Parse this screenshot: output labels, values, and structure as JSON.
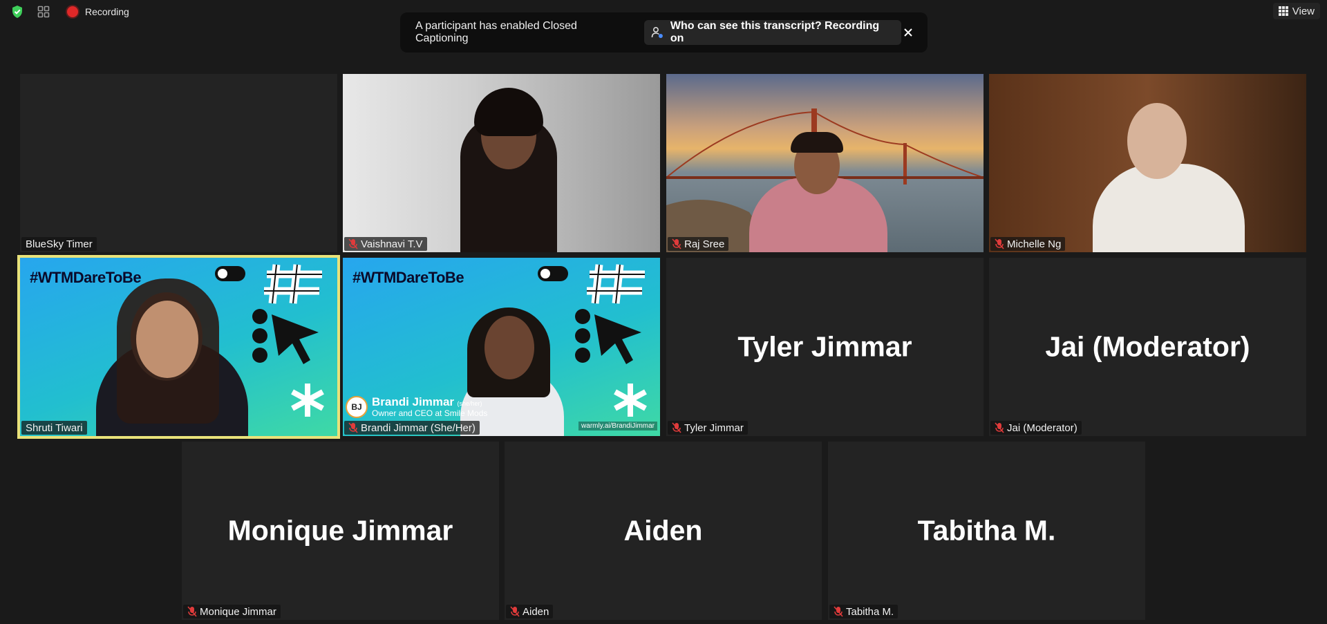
{
  "topbar": {
    "recording_label": "Recording",
    "view_label": "View"
  },
  "banner": {
    "message": "A participant has enabled Closed Captioning",
    "transcript_button": "Who can see this transcript? Recording on"
  },
  "tiles": [
    {
      "name": "BlueSky Timer",
      "muted": false
    },
    {
      "name": "Vaishnavi T.V",
      "muted": true
    },
    {
      "name": "Raj Sree",
      "muted": true
    },
    {
      "name": "Michelle Ng",
      "muted": true
    },
    {
      "name": "Shruti Tiwari",
      "muted": false,
      "active_speaker": true,
      "background_text": "#WTMDareToBe"
    },
    {
      "name": "Brandi Jimmar (She/Her)",
      "muted": true,
      "background_text": "#WTMDareToBe",
      "lower_third_name": "Brandi Jimmar",
      "lower_third_pronoun": "(she/her)",
      "lower_third_role": "Owner and CEO at Smile Mods",
      "badge": "BJ",
      "url": "warmly.ai/BrandiJimmar"
    },
    {
      "name": "Tyler Jimmar",
      "muted": true,
      "display_name": "Tyler Jimmar"
    },
    {
      "name": "Jai (Moderator)",
      "muted": true,
      "display_name": "Jai (Moderator)"
    },
    {
      "name": "Monique Jimmar",
      "muted": true,
      "display_name": "Monique Jimmar"
    },
    {
      "name": "Aiden",
      "muted": true,
      "display_name": "Aiden"
    },
    {
      "name": "Tabitha M.",
      "muted": true,
      "display_name": "Tabitha M."
    }
  ],
  "colors": {
    "active_speaker_border": "#e9e27a",
    "mute_icon": "#e03b3b",
    "recording_dot": "#e02828",
    "shield": "#3ecf5a"
  }
}
